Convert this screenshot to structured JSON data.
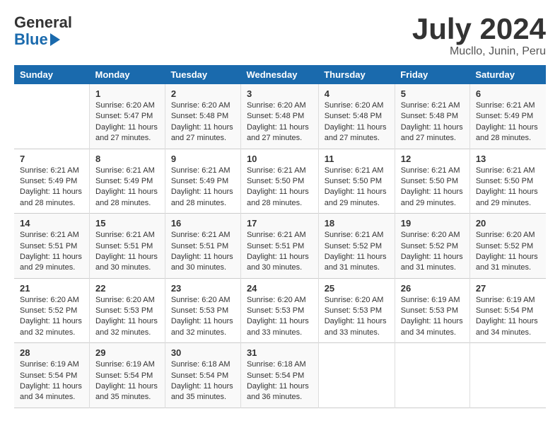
{
  "header": {
    "logo_general": "General",
    "logo_blue": "Blue",
    "month_year": "July 2024",
    "location": "Mucllo, Junin, Peru"
  },
  "days_of_week": [
    "Sunday",
    "Monday",
    "Tuesday",
    "Wednesday",
    "Thursday",
    "Friday",
    "Saturday"
  ],
  "weeks": [
    [
      {
        "day": "",
        "info": ""
      },
      {
        "day": "1",
        "info": "Sunrise: 6:20 AM\nSunset: 5:47 PM\nDaylight: 11 hours and 27 minutes."
      },
      {
        "day": "2",
        "info": "Sunrise: 6:20 AM\nSunset: 5:48 PM\nDaylight: 11 hours and 27 minutes."
      },
      {
        "day": "3",
        "info": "Sunrise: 6:20 AM\nSunset: 5:48 PM\nDaylight: 11 hours and 27 minutes."
      },
      {
        "day": "4",
        "info": "Sunrise: 6:20 AM\nSunset: 5:48 PM\nDaylight: 11 hours and 27 minutes."
      },
      {
        "day": "5",
        "info": "Sunrise: 6:21 AM\nSunset: 5:48 PM\nDaylight: 11 hours and 27 minutes."
      },
      {
        "day": "6",
        "info": "Sunrise: 6:21 AM\nSunset: 5:49 PM\nDaylight: 11 hours and 28 minutes."
      }
    ],
    [
      {
        "day": "7",
        "info": "Sunrise: 6:21 AM\nSunset: 5:49 PM\nDaylight: 11 hours and 28 minutes."
      },
      {
        "day": "8",
        "info": "Sunrise: 6:21 AM\nSunset: 5:49 PM\nDaylight: 11 hours and 28 minutes."
      },
      {
        "day": "9",
        "info": "Sunrise: 6:21 AM\nSunset: 5:49 PM\nDaylight: 11 hours and 28 minutes."
      },
      {
        "day": "10",
        "info": "Sunrise: 6:21 AM\nSunset: 5:50 PM\nDaylight: 11 hours and 28 minutes."
      },
      {
        "day": "11",
        "info": "Sunrise: 6:21 AM\nSunset: 5:50 PM\nDaylight: 11 hours and 29 minutes."
      },
      {
        "day": "12",
        "info": "Sunrise: 6:21 AM\nSunset: 5:50 PM\nDaylight: 11 hours and 29 minutes."
      },
      {
        "day": "13",
        "info": "Sunrise: 6:21 AM\nSunset: 5:50 PM\nDaylight: 11 hours and 29 minutes."
      }
    ],
    [
      {
        "day": "14",
        "info": "Sunrise: 6:21 AM\nSunset: 5:51 PM\nDaylight: 11 hours and 29 minutes."
      },
      {
        "day": "15",
        "info": "Sunrise: 6:21 AM\nSunset: 5:51 PM\nDaylight: 11 hours and 30 minutes."
      },
      {
        "day": "16",
        "info": "Sunrise: 6:21 AM\nSunset: 5:51 PM\nDaylight: 11 hours and 30 minutes."
      },
      {
        "day": "17",
        "info": "Sunrise: 6:21 AM\nSunset: 5:51 PM\nDaylight: 11 hours and 30 minutes."
      },
      {
        "day": "18",
        "info": "Sunrise: 6:21 AM\nSunset: 5:52 PM\nDaylight: 11 hours and 31 minutes."
      },
      {
        "day": "19",
        "info": "Sunrise: 6:20 AM\nSunset: 5:52 PM\nDaylight: 11 hours and 31 minutes."
      },
      {
        "day": "20",
        "info": "Sunrise: 6:20 AM\nSunset: 5:52 PM\nDaylight: 11 hours and 31 minutes."
      }
    ],
    [
      {
        "day": "21",
        "info": "Sunrise: 6:20 AM\nSunset: 5:52 PM\nDaylight: 11 hours and 32 minutes."
      },
      {
        "day": "22",
        "info": "Sunrise: 6:20 AM\nSunset: 5:53 PM\nDaylight: 11 hours and 32 minutes."
      },
      {
        "day": "23",
        "info": "Sunrise: 6:20 AM\nSunset: 5:53 PM\nDaylight: 11 hours and 32 minutes."
      },
      {
        "day": "24",
        "info": "Sunrise: 6:20 AM\nSunset: 5:53 PM\nDaylight: 11 hours and 33 minutes."
      },
      {
        "day": "25",
        "info": "Sunrise: 6:20 AM\nSunset: 5:53 PM\nDaylight: 11 hours and 33 minutes."
      },
      {
        "day": "26",
        "info": "Sunrise: 6:19 AM\nSunset: 5:53 PM\nDaylight: 11 hours and 34 minutes."
      },
      {
        "day": "27",
        "info": "Sunrise: 6:19 AM\nSunset: 5:54 PM\nDaylight: 11 hours and 34 minutes."
      }
    ],
    [
      {
        "day": "28",
        "info": "Sunrise: 6:19 AM\nSunset: 5:54 PM\nDaylight: 11 hours and 34 minutes."
      },
      {
        "day": "29",
        "info": "Sunrise: 6:19 AM\nSunset: 5:54 PM\nDaylight: 11 hours and 35 minutes."
      },
      {
        "day": "30",
        "info": "Sunrise: 6:18 AM\nSunset: 5:54 PM\nDaylight: 11 hours and 35 minutes."
      },
      {
        "day": "31",
        "info": "Sunrise: 6:18 AM\nSunset: 5:54 PM\nDaylight: 11 hours and 36 minutes."
      },
      {
        "day": "",
        "info": ""
      },
      {
        "day": "",
        "info": ""
      },
      {
        "day": "",
        "info": ""
      }
    ]
  ]
}
